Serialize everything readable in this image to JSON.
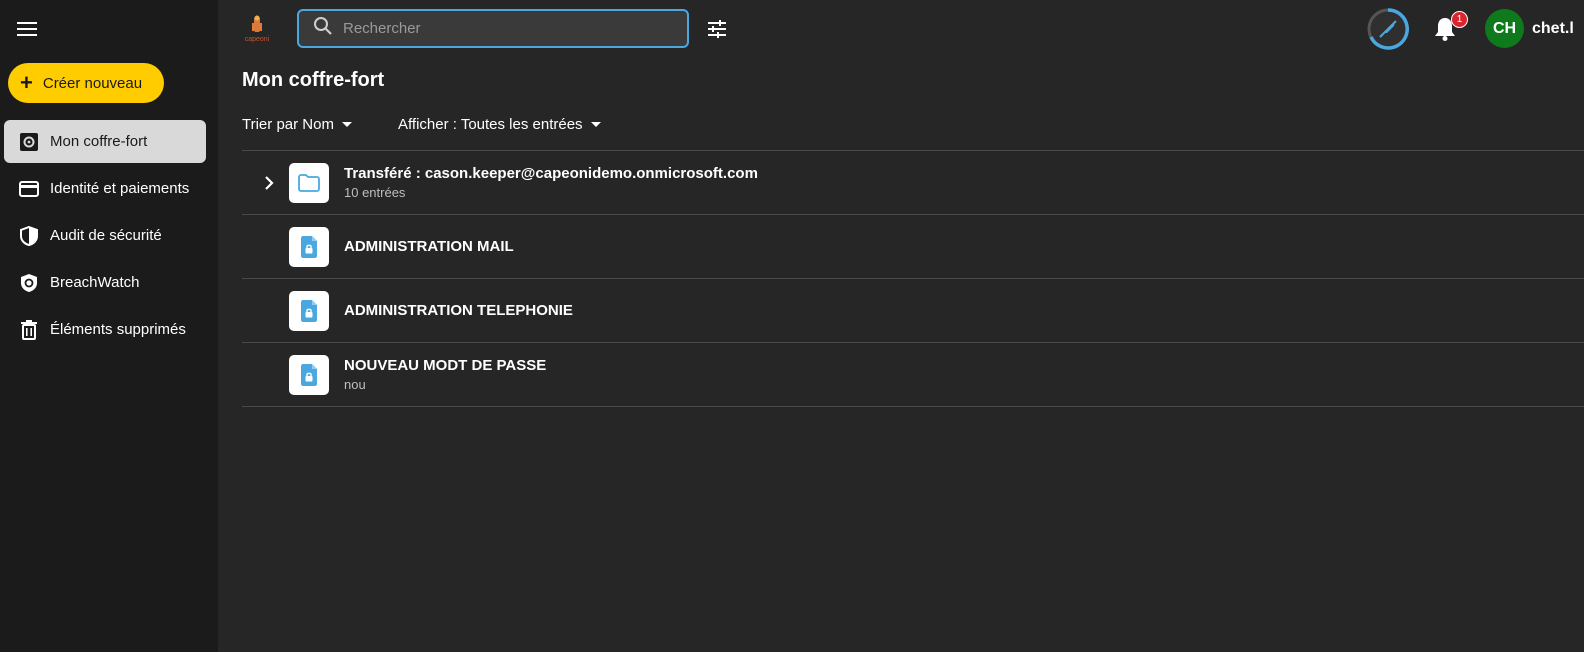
{
  "topbar": {
    "logo_text": "capeoni",
    "search_placeholder": "Rechercher",
    "notification_count": "1",
    "avatar_initials": "CH",
    "username": "chet.l"
  },
  "sidebar": {
    "create_label": "Créer nouveau",
    "items": [
      {
        "label": "Mon coffre-fort",
        "icon": "vault-icon",
        "active": true
      },
      {
        "label": "Identité et paiements",
        "icon": "credit-card-icon"
      },
      {
        "label": "Audit de sécurité",
        "icon": "shield-icon"
      },
      {
        "label": "BreachWatch",
        "icon": "breachwatch-icon"
      },
      {
        "label": "Éléments supprimés",
        "icon": "trash-icon"
      }
    ]
  },
  "main": {
    "title": "Mon coffre-fort",
    "sort_label": "Trier par Nom",
    "filter_label": "Afficher : Toutes les entrées",
    "rows": [
      {
        "type": "folder",
        "title": "Transféré : cason.keeper@capeonidemo.onmicrosoft.com",
        "subtitle": "10 entrées"
      },
      {
        "type": "record",
        "title": "ADMINISTRATION MAIL",
        "subtitle": ""
      },
      {
        "type": "record",
        "title": "ADMINISTRATION TELEPHONIE",
        "subtitle": ""
      },
      {
        "type": "record",
        "title": "NOUVEAU MODT DE PASSE",
        "subtitle": "nou"
      }
    ]
  },
  "colors": {
    "accent": "#ffcc00",
    "search_border": "#4aa8e0",
    "icon_blue": "#4aa8e0",
    "avatar_bg": "#0f7a1c",
    "badge": "#d9262e"
  }
}
